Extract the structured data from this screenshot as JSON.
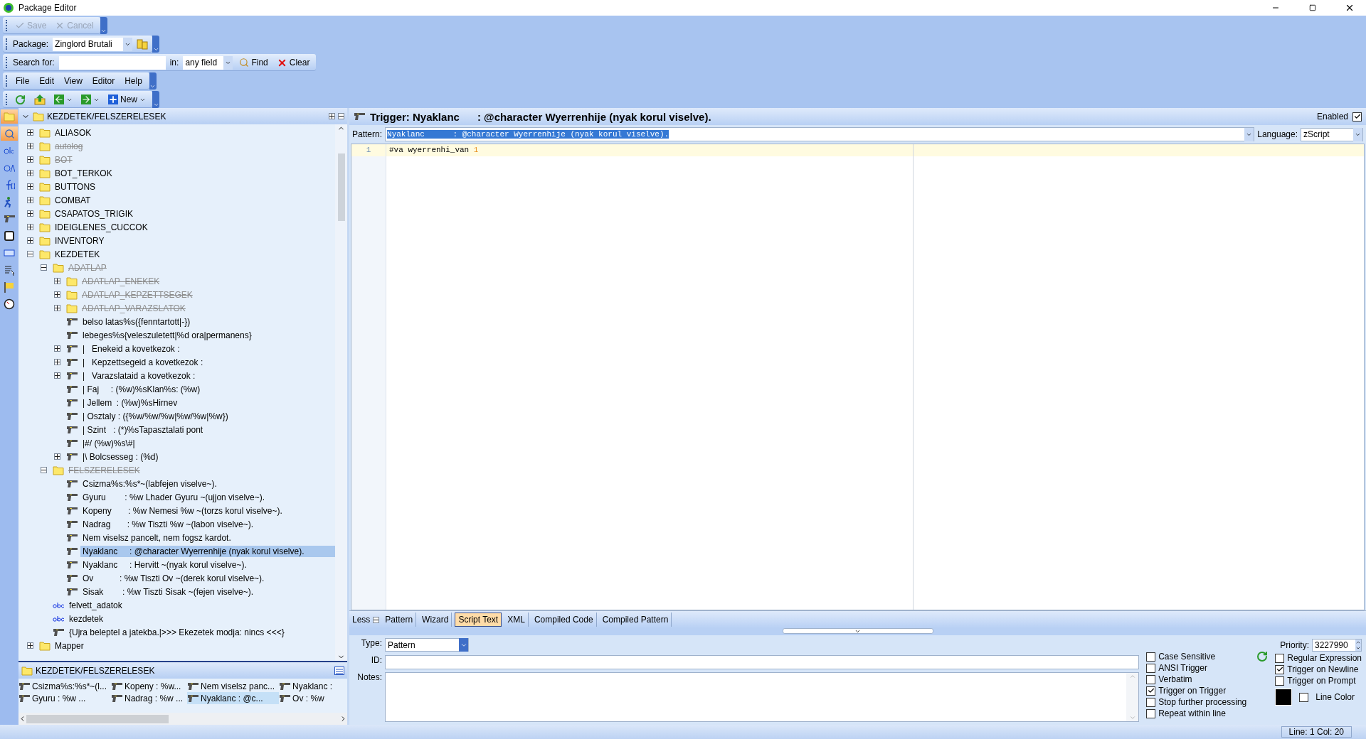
{
  "window": {
    "title": "Package Editor"
  },
  "toolbars": {
    "edit": [
      {
        "label": "Save",
        "disabled": true
      },
      {
        "label": "Cancel",
        "disabled": true
      }
    ],
    "package": {
      "label": "Package:",
      "value": "Zinglord Brutali"
    },
    "search": {
      "label": "Search for:",
      "in_label": "in:",
      "field": "any field",
      "find": "Find",
      "clear": "Clear"
    },
    "menu": [
      "File",
      "Edit",
      "View",
      "Editor",
      "Help"
    ],
    "actions": {
      "new": "New"
    }
  },
  "side_tools": [
    {
      "kind": "folder",
      "selected": true
    },
    {
      "kind": "search",
      "selected": true
    },
    {
      "kind": "variable",
      "selected": false
    },
    {
      "kind": "alias",
      "selected": false
    },
    {
      "kind": "function",
      "selected": false
    },
    {
      "kind": "runner",
      "selected": false
    },
    {
      "kind": "trigger",
      "selected": false
    },
    {
      "kind": "key",
      "selected": false
    },
    {
      "kind": "label",
      "selected": false
    },
    {
      "kind": "list",
      "selected": false
    },
    {
      "kind": "flag",
      "selected": false
    },
    {
      "kind": "clock",
      "selected": false
    }
  ],
  "tree": {
    "header": "KEZDETEK/FELSZERELESEK",
    "items": [
      {
        "kind": "folder",
        "label": "ALIASOK",
        "disabled": false,
        "expanded": false,
        "selected": false
      },
      {
        "kind": "folder",
        "label": "autolog",
        "disabled": true,
        "expanded": false,
        "selected": false
      },
      {
        "kind": "folder",
        "label": "BOT",
        "disabled": true,
        "expanded": false,
        "selected": false
      },
      {
        "kind": "folder",
        "label": "BOT_TERKOK",
        "disabled": false,
        "expanded": false,
        "selected": false
      },
      {
        "kind": "folder",
        "label": "BUTTONS",
        "disabled": false,
        "expanded": false,
        "selected": false
      },
      {
        "kind": "folder",
        "label": "COMBAT",
        "disabled": false,
        "expanded": false,
        "selected": false
      },
      {
        "kind": "folder",
        "label": "CSAPATOS_TRIGIK",
        "disabled": false,
        "expanded": false,
        "selected": false
      },
      {
        "kind": "folder",
        "label": "IDEIGLENES_CUCCOK",
        "disabled": false,
        "expanded": false,
        "selected": false
      },
      {
        "kind": "folder",
        "label": "INVENTORY",
        "disabled": false,
        "expanded": false,
        "selected": false
      },
      {
        "kind": "folder",
        "label": "KEZDETEK",
        "disabled": false,
        "expanded": true,
        "selected": false,
        "children": [
          {
            "kind": "folder",
            "label": "ADATLAP",
            "disabled": true,
            "expanded": true,
            "selected": false,
            "children": [
              {
                "kind": "folder",
                "label": "ADATLAP_ENEKEK",
                "disabled": true,
                "expanded": false,
                "selected": false
              },
              {
                "kind": "folder",
                "label": "ADATLAP_KEPZETTSEGEK",
                "disabled": true,
                "expanded": false,
                "selected": false
              },
              {
                "kind": "folder",
                "label": "ADATLAP_VARAZSLATOK",
                "disabled": true,
                "expanded": false,
                "selected": false
              },
              {
                "kind": "trigger",
                "label": "belso latas%s({fenntartott|-})",
                "disabled": false,
                "selected": false
              },
              {
                "kind": "trigger",
                "label": "lebeges%s{veleszuletett|%d ora|permanens}",
                "disabled": false,
                "selected": false
              },
              {
                "kind": "trigger",
                "label": "|   Enekeid a kovetkezok :",
                "disabled": false,
                "expanded": false,
                "selected": false
              },
              {
                "kind": "trigger",
                "label": "|   Kepzettsegeid a kovetkezok :",
                "disabled": false,
                "expanded": false,
                "selected": false
              },
              {
                "kind": "trigger",
                "label": "|   Varazslataid a kovetkezok :",
                "disabled": false,
                "expanded": false,
                "selected": false
              },
              {
                "kind": "trigger",
                "label": "| Faj     : (%w)%sKlan%s: (%w)",
                "disabled": false,
                "selected": false
              },
              {
                "kind": "trigger",
                "label": "| Jellem  : (%w)%sHirnev",
                "disabled": false,
                "selected": false
              },
              {
                "kind": "trigger",
                "label": "| Osztaly : ({%w/%w/%w|%w/%w|%w})",
                "disabled": false,
                "selected": false
              },
              {
                "kind": "trigger",
                "label": "| Szint   : (*)%sTapasztalati pont",
                "disabled": false,
                "selected": false
              },
              {
                "kind": "trigger",
                "label": "|#/ (%w)%s\\#|",
                "disabled": false,
                "selected": false
              },
              {
                "kind": "trigger",
                "label": "|\\ Bolcsesseg : (%d)",
                "disabled": false,
                "expanded": false,
                "selected": false
              }
            ]
          },
          {
            "kind": "folder",
            "label": "FELSZERELESEK",
            "disabled": true,
            "expanded": true,
            "selected": false,
            "children": [
              {
                "kind": "trigger",
                "label": "Csizma%s:%s*~(labfejen viselve~).",
                "disabled": false,
                "selected": false
              },
              {
                "kind": "trigger",
                "label": "Gyuru        : %w Lhader Gyuru ~(ujjon viselve~).",
                "disabled": false,
                "selected": false
              },
              {
                "kind": "trigger",
                "label": "Kopeny       : %w Nemesi %w ~(torzs korul viselve~).",
                "disabled": false,
                "selected": false
              },
              {
                "kind": "trigger",
                "label": "Nadrag       : %w Tiszti %w ~(labon viselve~).",
                "disabled": false,
                "selected": false
              },
              {
                "kind": "trigger",
                "label": "Nem viselsz pancelt, nem fogsz kardot.",
                "disabled": false,
                "selected": false
              },
              {
                "kind": "trigger",
                "label": "Nyaklanc     : @character Wyerrenhije (nyak korul viselve).",
                "disabled": false,
                "selected": true
              },
              {
                "kind": "trigger",
                "label": "Nyaklanc     : Hervitt ~(nyak korul viselve~).",
                "disabled": false,
                "selected": false
              },
              {
                "kind": "trigger",
                "label": "Ov           : %w Tiszti Ov ~(derek korul viselve~).",
                "disabled": false,
                "selected": false
              },
              {
                "kind": "trigger",
                "label": "Sisak        : %w Tiszti Sisak ~(fejen viselve~).",
                "disabled": false,
                "selected": false
              }
            ]
          },
          {
            "kind": "variable",
            "label": "felvett_adatok",
            "disabled": false,
            "selected": false
          },
          {
            "kind": "variable",
            "label": "kezdetek",
            "disabled": false,
            "selected": false
          },
          {
            "kind": "trigger",
            "label": "{Ujra beleptel a jatekba.|>>> Ekezetek modja: nincs <<<}",
            "disabled": false,
            "selected": false
          }
        ]
      },
      {
        "kind": "folder",
        "label": "Mapper",
        "disabled": false,
        "expanded": false,
        "selected": false
      }
    ]
  },
  "list_panel": {
    "header": "KEZDETEK/FELSZERELESEK",
    "items": [
      {
        "label": "Csizma%s:%s*~(l...",
        "selected": false
      },
      {
        "label": "Gyuru : %w ...",
        "selected": false
      },
      {
        "label": "Kopeny : %w...",
        "selected": false
      },
      {
        "label": "Nadrag : %w ...",
        "selected": false
      },
      {
        "label": "Nem viselsz panc...",
        "selected": false
      },
      {
        "label": "Nyaklanc : @c...",
        "selected": true
      },
      {
        "label": "Nyaklanc :",
        "selected": false
      },
      {
        "label": "Ov : %w",
        "selected": false
      }
    ]
  },
  "editor": {
    "title": "Trigger: Nyaklanc      : @character Wyerrenhije (nyak korul viselve).",
    "enabled_label": "Enabled",
    "enabled": true,
    "pattern_label": "Pattern:",
    "pattern": "Nyaklanc      : @character Wyerrenhije (nyak korul viselve).",
    "pattern_selected": true,
    "language_label": "Language:",
    "language": "zScript",
    "lines": [
      {
        "number": "1",
        "tokens": [
          {
            "kind": "plain",
            "text": "#va wyerrenhi_van "
          },
          {
            "kind": "number",
            "text": "1"
          }
        ]
      }
    ],
    "less_label": "Less",
    "tabs": [
      {
        "label": "Pattern",
        "selected": false
      },
      {
        "label": "Wizard",
        "selected": false
      },
      {
        "label": "Script Text",
        "selected": true
      },
      {
        "label": "XML",
        "selected": false
      },
      {
        "label": "Compiled Code",
        "selected": false
      },
      {
        "label": "Compiled Pattern",
        "selected": false
      }
    ],
    "type_label": "Type:",
    "type": "Pattern",
    "id_label": "ID:",
    "notes_label": "Notes:",
    "priority_label": "Priority:",
    "priority": "3227990",
    "options_left": [
      {
        "label": "Case Sensitive",
        "checked": false
      },
      {
        "label": "ANSI Trigger",
        "checked": false
      },
      {
        "label": "Verbatim",
        "checked": false
      },
      {
        "label": "Trigger on Trigger",
        "checked": true
      },
      {
        "label": "Stop further processing",
        "checked": false
      },
      {
        "label": "Repeat within line",
        "checked": false
      }
    ],
    "options_right": [
      {
        "label": "Regular Expression",
        "checked": false
      },
      {
        "label": "Trigger on Newline",
        "checked": true
      },
      {
        "label": "Trigger on Prompt",
        "checked": false
      }
    ],
    "line_color": {
      "label": "Line Color",
      "checked": false,
      "color": "#000000"
    }
  },
  "status_bar": {
    "position": "Line: 1 Col: 20"
  }
}
